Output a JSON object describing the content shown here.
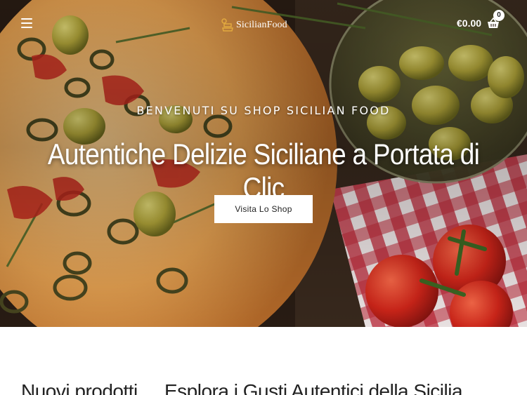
{
  "header": {
    "menu_icon": "hamburger-menu-icon",
    "logo_text": "SicilianFood",
    "cart_amount": "€0.00",
    "cart_icon": "shopping-basket-icon",
    "cart_count": "0"
  },
  "hero": {
    "kicker": "BENVENUTI SU SHOP SICILIAN FOOD",
    "title": "Autentiche Delizie Siciliane a Portata di Clic",
    "cta_label": "Visita Lo Shop"
  },
  "sections": {
    "new_products_heading": "Nuovi prodotti",
    "explore_heading": "Esplora i Gusti Autentici della Sicilia"
  },
  "colors": {
    "focaccia": "#e9a95a",
    "olive_green": "#a9a13c",
    "tomato_red": "#d62a1e",
    "button_bg": "#ffffff"
  }
}
